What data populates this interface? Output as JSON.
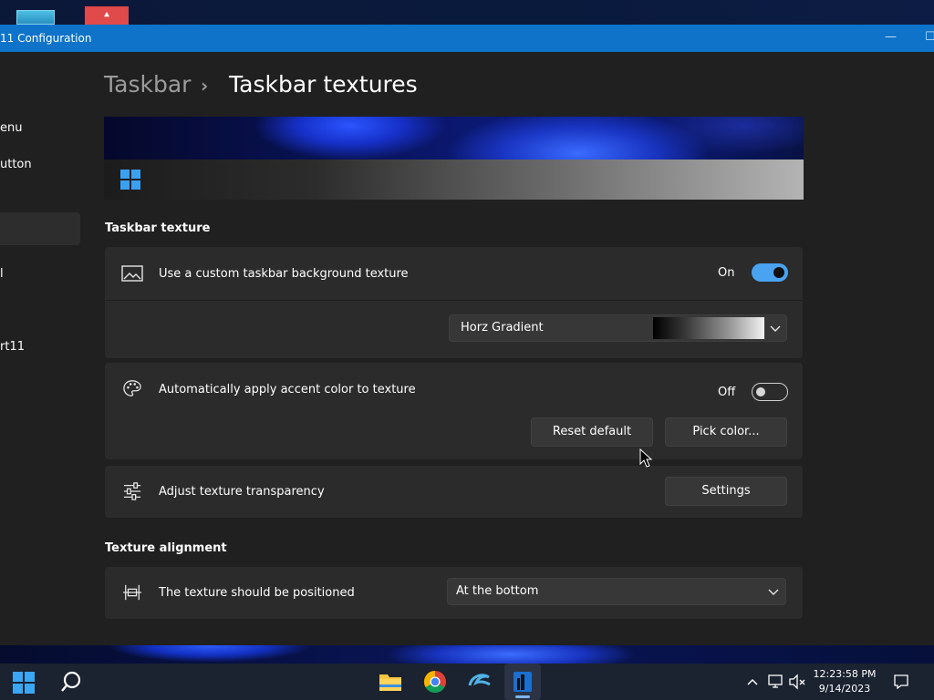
{
  "window": {
    "title": "11 Configuration",
    "minimize_glyph": "—",
    "maximize_glyph": "☐"
  },
  "desktop": {
    "icon_b_glyph": "⯅"
  },
  "sidebar": {
    "items": [
      {
        "label": "enu"
      },
      {
        "label": "utton"
      },
      {
        "label": ""
      },
      {
        "label": "l"
      },
      {
        "label": "rt11"
      }
    ]
  },
  "breadcrumb": {
    "parent": "Taskbar",
    "separator": "›",
    "current": "Taskbar textures"
  },
  "sections": {
    "texture_title": "Taskbar texture",
    "alignment_title": "Texture alignment"
  },
  "custom_texture": {
    "label": "Use a custom taskbar background texture",
    "state_label": "On",
    "enabled": true,
    "icon": "image-icon",
    "texture_select": {
      "value": "Horz Gradient"
    }
  },
  "accent_color": {
    "label": "Automatically apply accent color to texture",
    "state_label": "Off",
    "enabled": false,
    "icon": "palette-icon",
    "reset_label": "Reset default",
    "pick_label": "Pick color..."
  },
  "transparency": {
    "label": "Adjust texture transparency",
    "icon": "sliders-icon",
    "settings_label": "Settings"
  },
  "alignment": {
    "label": "The texture should be positioned",
    "icon": "align-icon",
    "select_value": "At the bottom"
  },
  "taskbar": {
    "apps": [
      "start-icon",
      "search-icon",
      "file-explorer-icon",
      "chrome-icon",
      "edge-dev-icon",
      "configurator-icon"
    ],
    "tray": [
      "chevron-up-icon",
      "network-icon",
      "volume-muted-icon",
      "notification-icon"
    ],
    "time": "12:23:58 PM",
    "date": "9/14/2023"
  },
  "colors": {
    "accent": "#4aa3f0",
    "titlebar": "#0e73c9",
    "card": "#2b2b2b",
    "background": "#202020"
  }
}
